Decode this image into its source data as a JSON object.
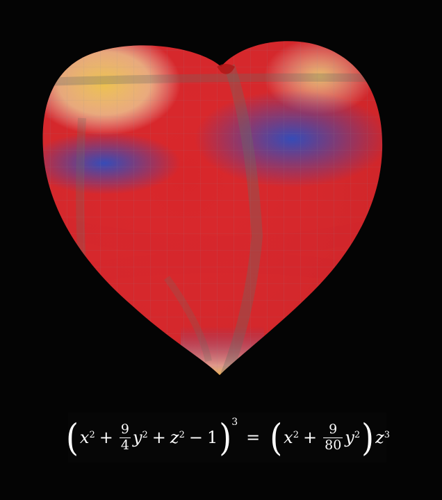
{
  "equation": {
    "lhs": {
      "t1": "x",
      "e1": "2",
      "plus1": "+",
      "f1_num": "9",
      "f1_den": "4",
      "t2": "y",
      "e2": "2",
      "plus2": "+",
      "t3": "z",
      "e3": "2",
      "minus": "−",
      "const": "1",
      "outer_exp": "3"
    },
    "eq": "=",
    "rhs": {
      "t1": "x",
      "e1": "2",
      "plus1": "+",
      "f1_num": "9",
      "f1_den": "80",
      "t2": "y",
      "e2": "2",
      "t3": "z",
      "e3": "3"
    }
  },
  "surface": {
    "colors": {
      "blue": "#2e4fbf",
      "white": "#f2f2f0",
      "yellow": "#f0c84a",
      "red": "#d8262a",
      "background": "#040404"
    }
  }
}
